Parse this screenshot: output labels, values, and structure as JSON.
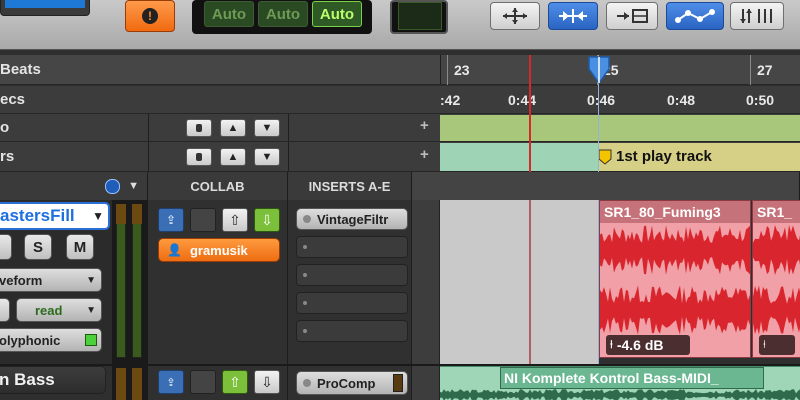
{
  "toolbar": {
    "alert_icon": "exclamation-icon",
    "automation_modes": [
      "Auto",
      "Auto",
      "Auto"
    ],
    "tool_icons": [
      "shuffle-arrows-icon",
      "slip-icon",
      "spot-icon",
      "grid-icon",
      "nudge-icon"
    ]
  },
  "rulers": {
    "bars_beats": {
      "label": "Beats",
      "ticks": [
        "23",
        "25",
        "27"
      ]
    },
    "min_secs": {
      "label": "ecs",
      "ticks": [
        ":42",
        "0:44",
        "0:46",
        "0:48",
        "0:50"
      ]
    },
    "tempo": {
      "label": "o"
    },
    "markers": {
      "label": "rs",
      "marker_text": "1st play track"
    }
  },
  "columns": {
    "collab": "COLLAB",
    "inserts": "INSERTS A-E"
  },
  "tracks": [
    {
      "name": "astersFill",
      "solo": "S",
      "mute": "M",
      "view": "veform",
      "automation": "read",
      "timebase": "olyphonic",
      "collab_user": "gramusik",
      "insert": "VintageFiltr",
      "clips": [
        {
          "title": "SR1_80_Fuming3",
          "gain": "-4.6 dB"
        },
        {
          "title": "SR1_",
          "gain": ""
        }
      ]
    },
    {
      "name": "n Bass",
      "insert": "ProComp",
      "clip_title": "NI Komplete Kontrol Bass-MIDI_"
    }
  ],
  "colors": {
    "accent_orange": "#ff7a1a",
    "tempo_lane": "#a9c77a",
    "marker_lane": "#9fd3b5",
    "audio_clip": "#f0a0a6",
    "waveform": "#d9262e",
    "midi_clip": "#9fd6b7"
  }
}
